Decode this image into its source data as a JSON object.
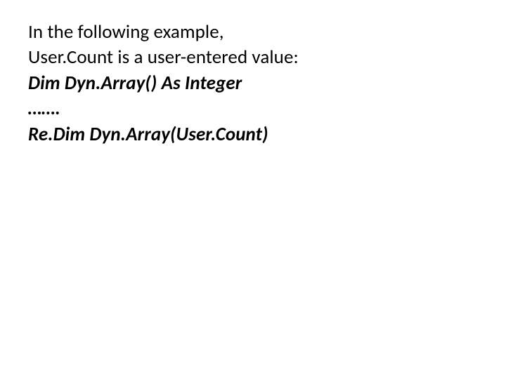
{
  "slide": {
    "lines": {
      "l1": "In the following example,",
      "l2": "User.Count is a user-entered value:",
      "l3": "Dim Dyn.Array() As Integer",
      "l4": "…….",
      "l5": "Re.Dim Dyn.Array(User.Count)"
    }
  }
}
